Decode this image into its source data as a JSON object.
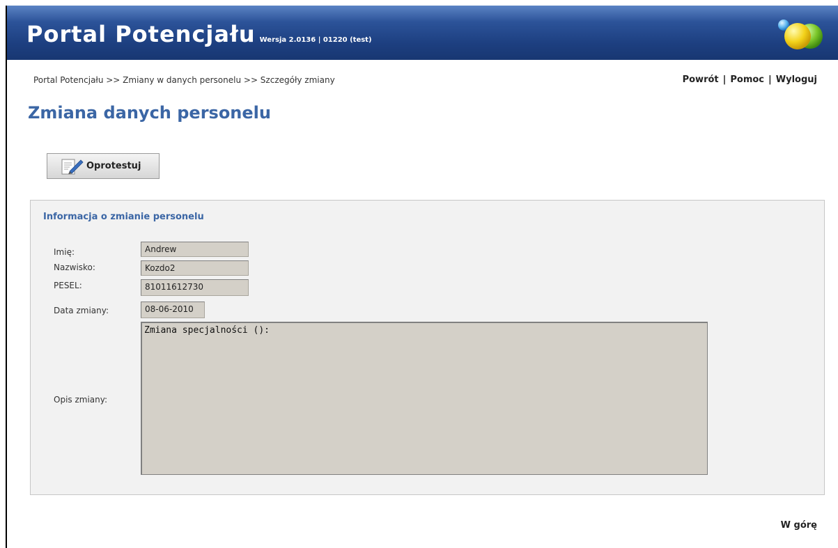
{
  "header": {
    "title": "Portal Potencjału",
    "version": "Wersja 2.0136 | 01220 (test)"
  },
  "breadcrumb": "Portal Potencjału >> Zmiany w danych personelu >> Szczegóły zmiany",
  "top_links": {
    "back": "Powrót",
    "help": "Pomoc",
    "logout": "Wyloguj"
  },
  "page_title": "Zmiana danych personelu",
  "action_button": {
    "label": "Oprotestuj"
  },
  "panel": {
    "title": "Informacja o zmianie personelu",
    "fields": {
      "first_name": {
        "label": "Imię:",
        "value": "Andrew"
      },
      "last_name": {
        "label": "Nazwisko:",
        "value": "Kozdo2"
      },
      "pesel": {
        "label": "PESEL:",
        "value": "81011612730"
      },
      "change_date": {
        "label": "Data zmiany:",
        "value": "08-06-2010"
      },
      "description": {
        "label": "Opis zmiany:",
        "value": "Zmiana specjalności ():"
      }
    }
  },
  "to_top": "W górę",
  "colors": {
    "header_blue": "#1d3f80",
    "title_blue": "#3b66a5",
    "field_bg": "#d4d0c8"
  }
}
